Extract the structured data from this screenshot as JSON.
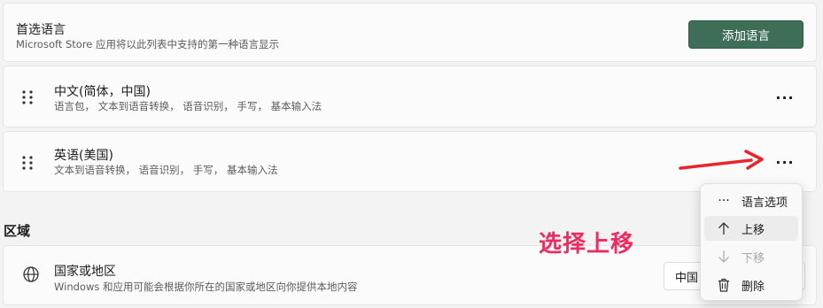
{
  "preferred_languages": {
    "title": "首选语言",
    "subtitle": "Microsoft Store 应用将以此列表中支持的第一种语言显示",
    "add_button": "添加语言"
  },
  "languages": [
    {
      "name": "中文(简体，中国)",
      "features": "语言包， 文本到语音转换， 语音识别， 手写， 基本输入法"
    },
    {
      "name": "英语(美国)",
      "features": "文本到语音转换， 语音识别， 手写， 基本输入法"
    }
  ],
  "more_icon": "···",
  "region": {
    "section_label": "区域",
    "title": "国家或地区",
    "subtitle": "Windows 和应用可能会根据你所在的国家或地区向你提供本地内容",
    "selected_value": "中国"
  },
  "annotation": {
    "text": "选择上移",
    "color": "#ee2a5f"
  },
  "context_menu": {
    "items": [
      {
        "label": "语言选项",
        "icon": "more-icon",
        "glyph": "···",
        "state": "normal"
      },
      {
        "label": "上移",
        "icon": "arrow-up-icon",
        "glyph": "↑",
        "state": "hover"
      },
      {
        "label": "下移",
        "icon": "arrow-down-icon",
        "glyph": "↓",
        "state": "disabled"
      },
      {
        "label": "删除",
        "icon": "trash-icon",
        "glyph": "🗑",
        "state": "normal"
      }
    ]
  },
  "colors": {
    "accent_button": "#3e6e57",
    "arrow": "#e8262a"
  }
}
